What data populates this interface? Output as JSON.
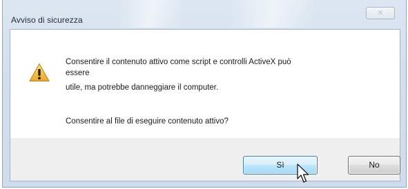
{
  "dialog": {
    "title": "Avviso di sicurezza",
    "close_icon": "close-icon",
    "message_line1": "Consentire il contenuto attivo come script e controlli ActiveX può",
    "message_line2": "essere",
    "message_line3": "utile, ma potrebbe danneggiare il computer.",
    "question": "Consentire al file di eseguire contenuto attivo?",
    "icon": "warning-icon",
    "buttons": {
      "yes_label": "Sì",
      "no_label": "No"
    }
  },
  "colors": {
    "frame": "#d3dfee",
    "client_bg": "#f0f0f0",
    "content_bg": "#ffffff",
    "default_button": "#bee6fd",
    "warning_yellow": "#f6c343"
  }
}
